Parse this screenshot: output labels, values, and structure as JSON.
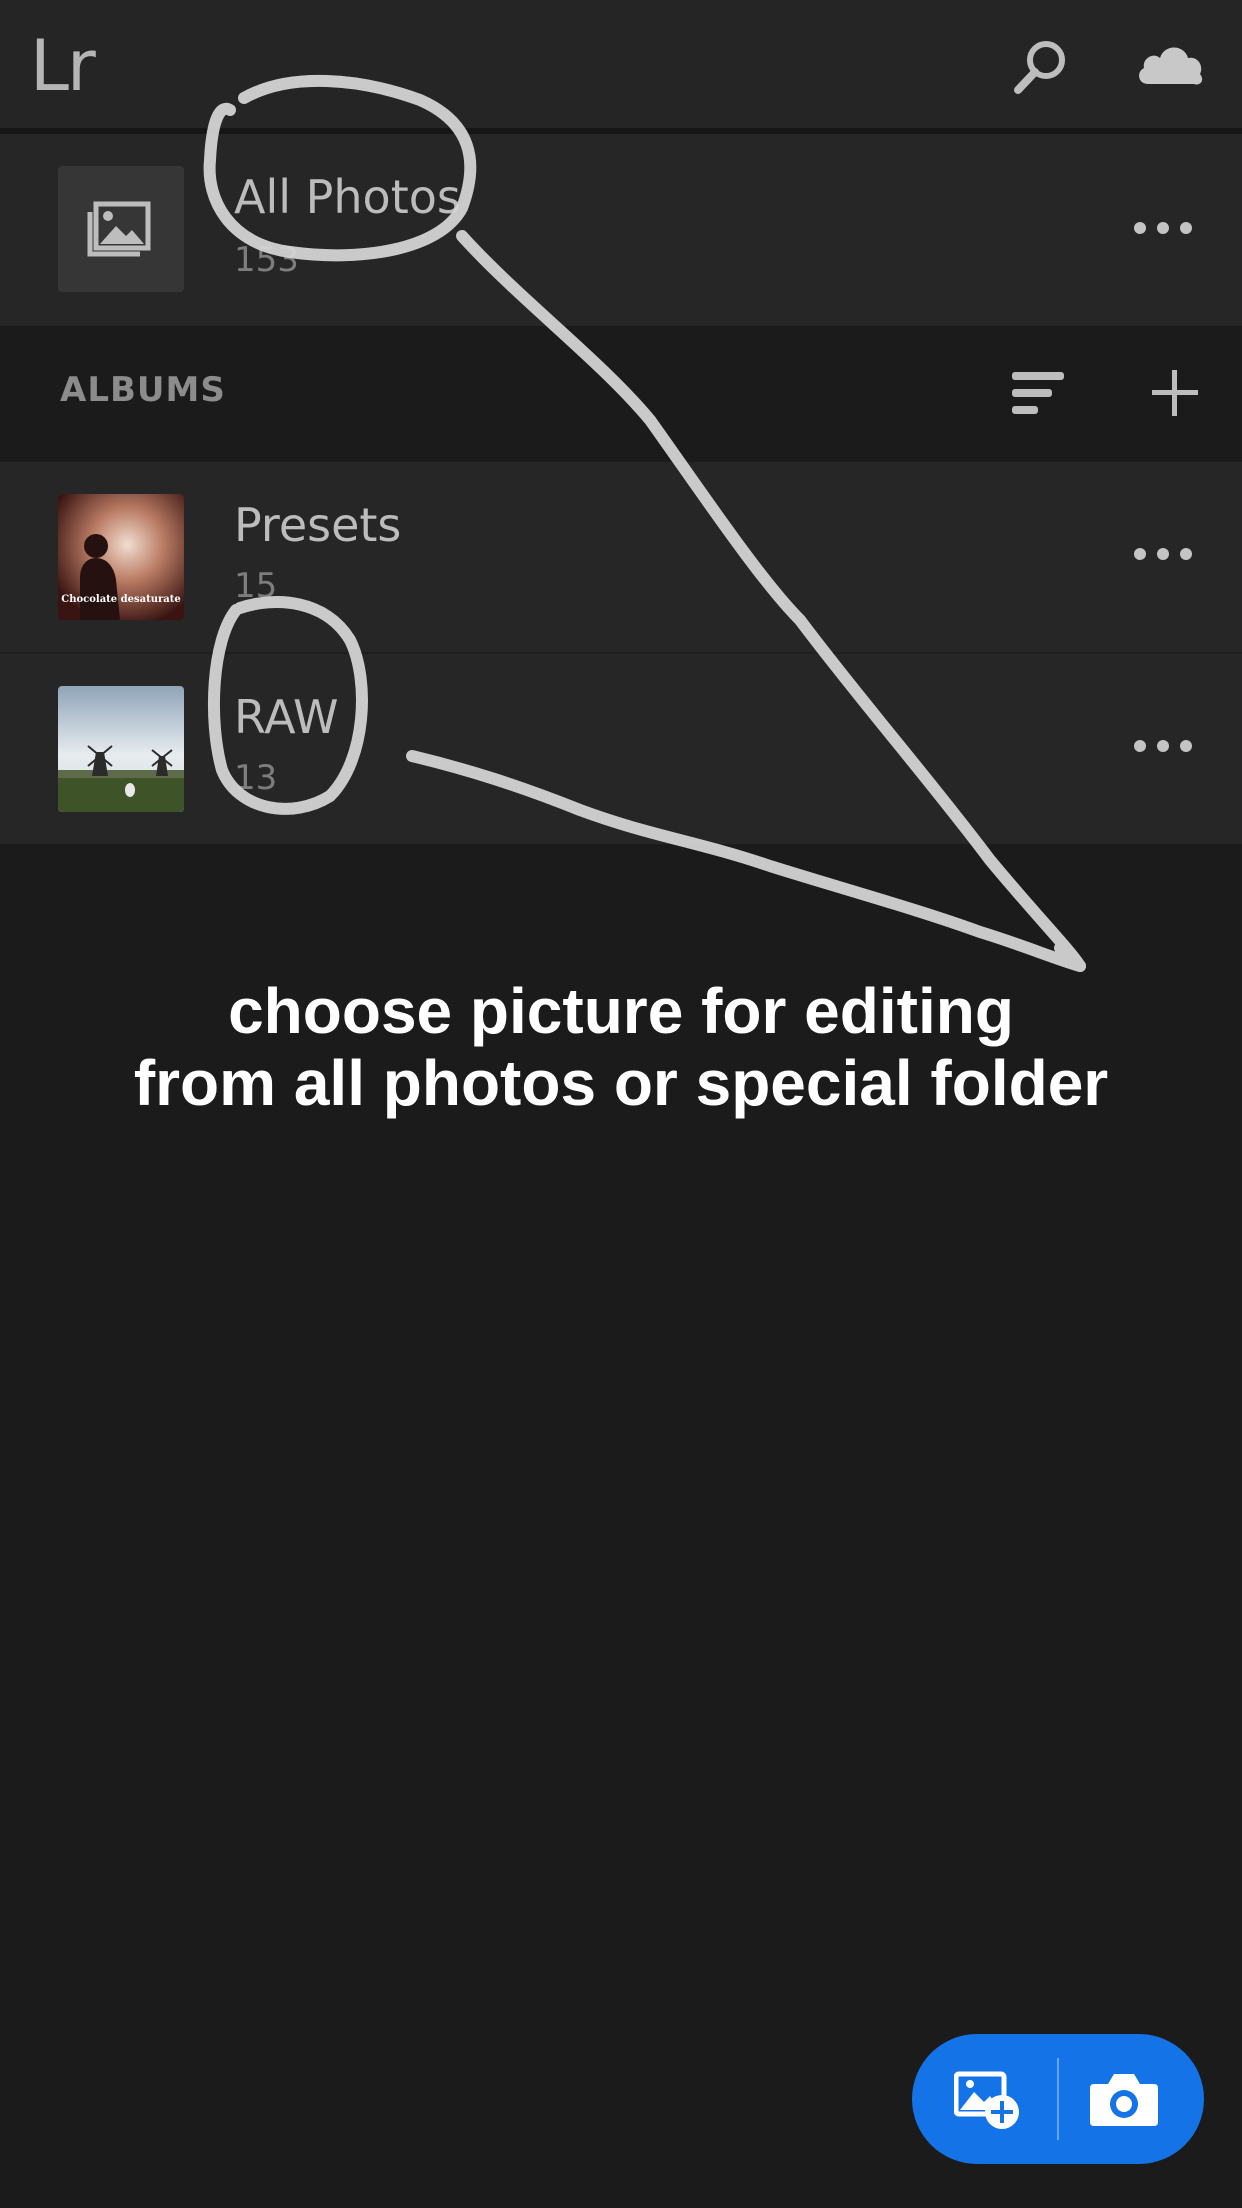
{
  "app": {
    "logo_text": "Lr"
  },
  "topbar": {
    "search_icon": "search-icon",
    "cloud_icon": "cloud-icon"
  },
  "all_photos": {
    "title": "All Photos",
    "count": "153",
    "icon": "photos-stack-icon"
  },
  "albums": {
    "header_label": "ALBUMS",
    "sort_icon": "sort-icon",
    "add_icon": "plus-icon",
    "items": [
      {
        "title": "Presets",
        "count": "15",
        "thumb_caption": "Chocolate desaturate"
      },
      {
        "title": "RAW",
        "count": "13"
      }
    ]
  },
  "annotation": {
    "line1": "choose picture for editing",
    "line2": "from all photos or special folder"
  },
  "fab": {
    "import_icon": "add-photo-icon",
    "camera_icon": "camera-icon",
    "accent": "#1473e6"
  }
}
